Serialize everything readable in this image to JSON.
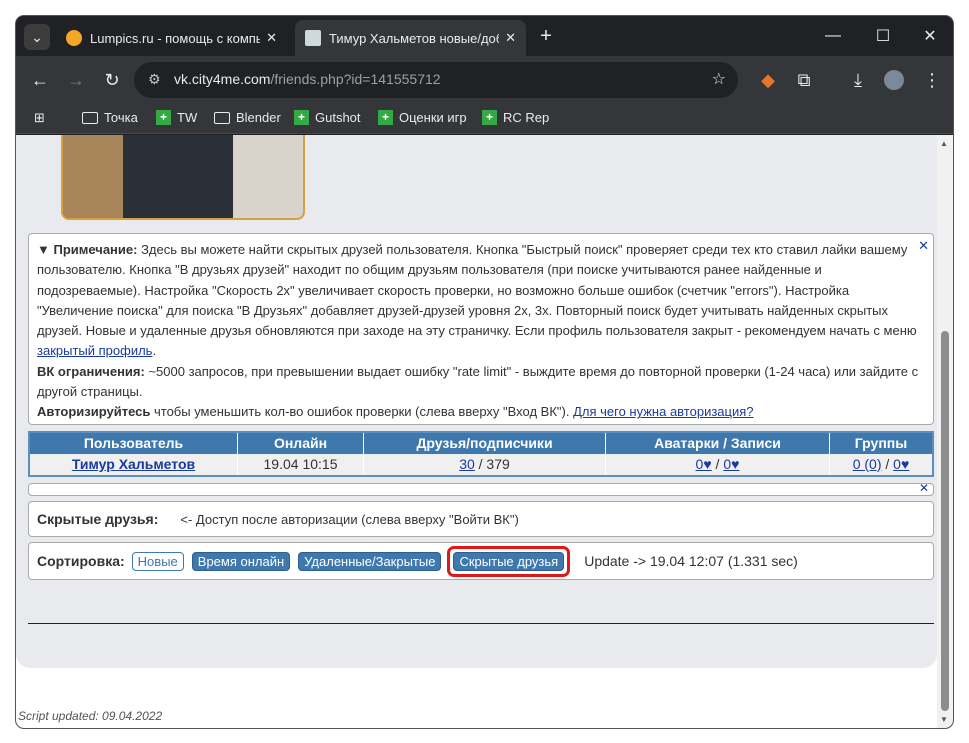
{
  "browser": {
    "tabs": [
      {
        "title": "Lumpics.ru - помощь с компьютером",
        "favicon_color": "#f5a623"
      },
      {
        "title": "Тимур Хальметов новые/добавленные",
        "favicon_color": "#cfd8dc"
      }
    ],
    "url_host": "vk.city4me.com",
    "url_path": "/friends.php?id=141555712",
    "bookmarks": [
      "Точка",
      "TW",
      "Blender",
      "Gutshot",
      "Оценки игр",
      "RC Rep"
    ]
  },
  "note": {
    "title": "Примечание:",
    "text1": " Здесь вы можете найти скрытых друзей пользователя. Кнопка \"Быстрый поиск\" проверяет среди тех кто ставил лайки вашему пользователю. Кнопка \"В друзьях друзей\" находит по общим друзьям пользователя (при поиске учитываются ранее найденные и подозреваемые). Настройка \"Скорость 2х\" увеличивает скорость проверки, но возможно больше ошибок (счетчик \"errors\"). Настройка \"Увеличение поиска\" для поиска \"В Друзьях\" добавляет друзей-друзей уровня 2х, 3х. Повторный поиск будет учитывать найденных скрытых друзей. Новые и удаленные друзья обновляются при заходе на эту страничку. Если профиль пользователя закрыт - рекомендуем начать с меню ",
    "link1": "закрытый профиль",
    "limits_label": "ВК ограничения:",
    "limits_text": " ~5000 запросов, при превышении выдает ошибку \"rate limit\" - выждите время до повторной проверки (1-24 часа) или зайдите с другой страницы.",
    "auth_label": "Авторизируйтесь",
    "auth_text": " чтобы уменьшить кол-во ошибок проверки (слева вверху \"Вход ВК\"). ",
    "auth_link": "Для чего нужна авторизация?"
  },
  "table": {
    "headers": [
      "Пользователь",
      "Онлайн",
      "Друзья/подписчики",
      "Аватарки / Записи",
      "Группы"
    ],
    "user": "Тимур Хальметов",
    "online": "19.04 10:15",
    "friends": "30",
    "followers": " / 379",
    "avatars": "0♥",
    "posts": "0♥",
    "groups": "0 (0)",
    "groups_likes": "0♥"
  },
  "hidden_friends": {
    "label": "Скрытые друзья:",
    "text": "<- Доступ после авторизации (слева вверху \"Войти ВК\")"
  },
  "sort": {
    "label": "Сортировка:",
    "buttons": [
      "Новые",
      "Время онлайн",
      "Удаленные/Закрытые",
      "Скрытые друзья"
    ],
    "update": "Update -> 19.04 12:07 (1.331 sec)"
  },
  "footer": "Script updated: 09.04.2022",
  "colors": {
    "accent": "#3e78ac",
    "highlight": "#e01818",
    "link": "#1a3aa0"
  }
}
